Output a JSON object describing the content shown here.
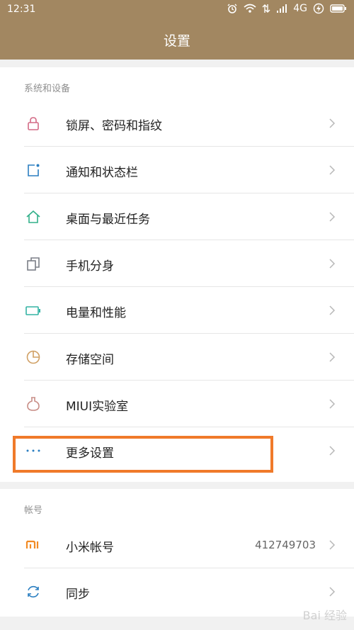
{
  "status_bar": {
    "time": "12:31",
    "network": "4G"
  },
  "header": {
    "title": "设置"
  },
  "sections": [
    {
      "title": "系统和设备",
      "items": [
        {
          "label": "锁屏、密码和指纹",
          "icon": "lock-icon",
          "color": "#d36b86"
        },
        {
          "label": "通知和状态栏",
          "icon": "notification-square-icon",
          "color": "#2b7fc1"
        },
        {
          "label": "桌面与最近任务",
          "icon": "home-icon",
          "color": "#32b08a"
        },
        {
          "label": "手机分身",
          "icon": "clone-icon",
          "color": "#7b7f87"
        },
        {
          "label": "电量和性能",
          "icon": "battery-icon",
          "color": "#33b3a4"
        },
        {
          "label": "存储空间",
          "icon": "pie-icon",
          "color": "#d0a064"
        },
        {
          "label": "MIUI实验室",
          "icon": "flask-icon",
          "color": "#c98f88"
        },
        {
          "label": "更多设置",
          "icon": "more-dots-icon",
          "color": "#2b7fc1"
        }
      ]
    },
    {
      "title": "帐号",
      "items": [
        {
          "label": "小米帐号",
          "value": "412749703",
          "icon": "mi-logo-icon",
          "color": "#f28b24"
        },
        {
          "label": "同步",
          "icon": "sync-icon",
          "color": "#2b7fc1"
        }
      ]
    }
  ],
  "watermark": "Bai 经验"
}
